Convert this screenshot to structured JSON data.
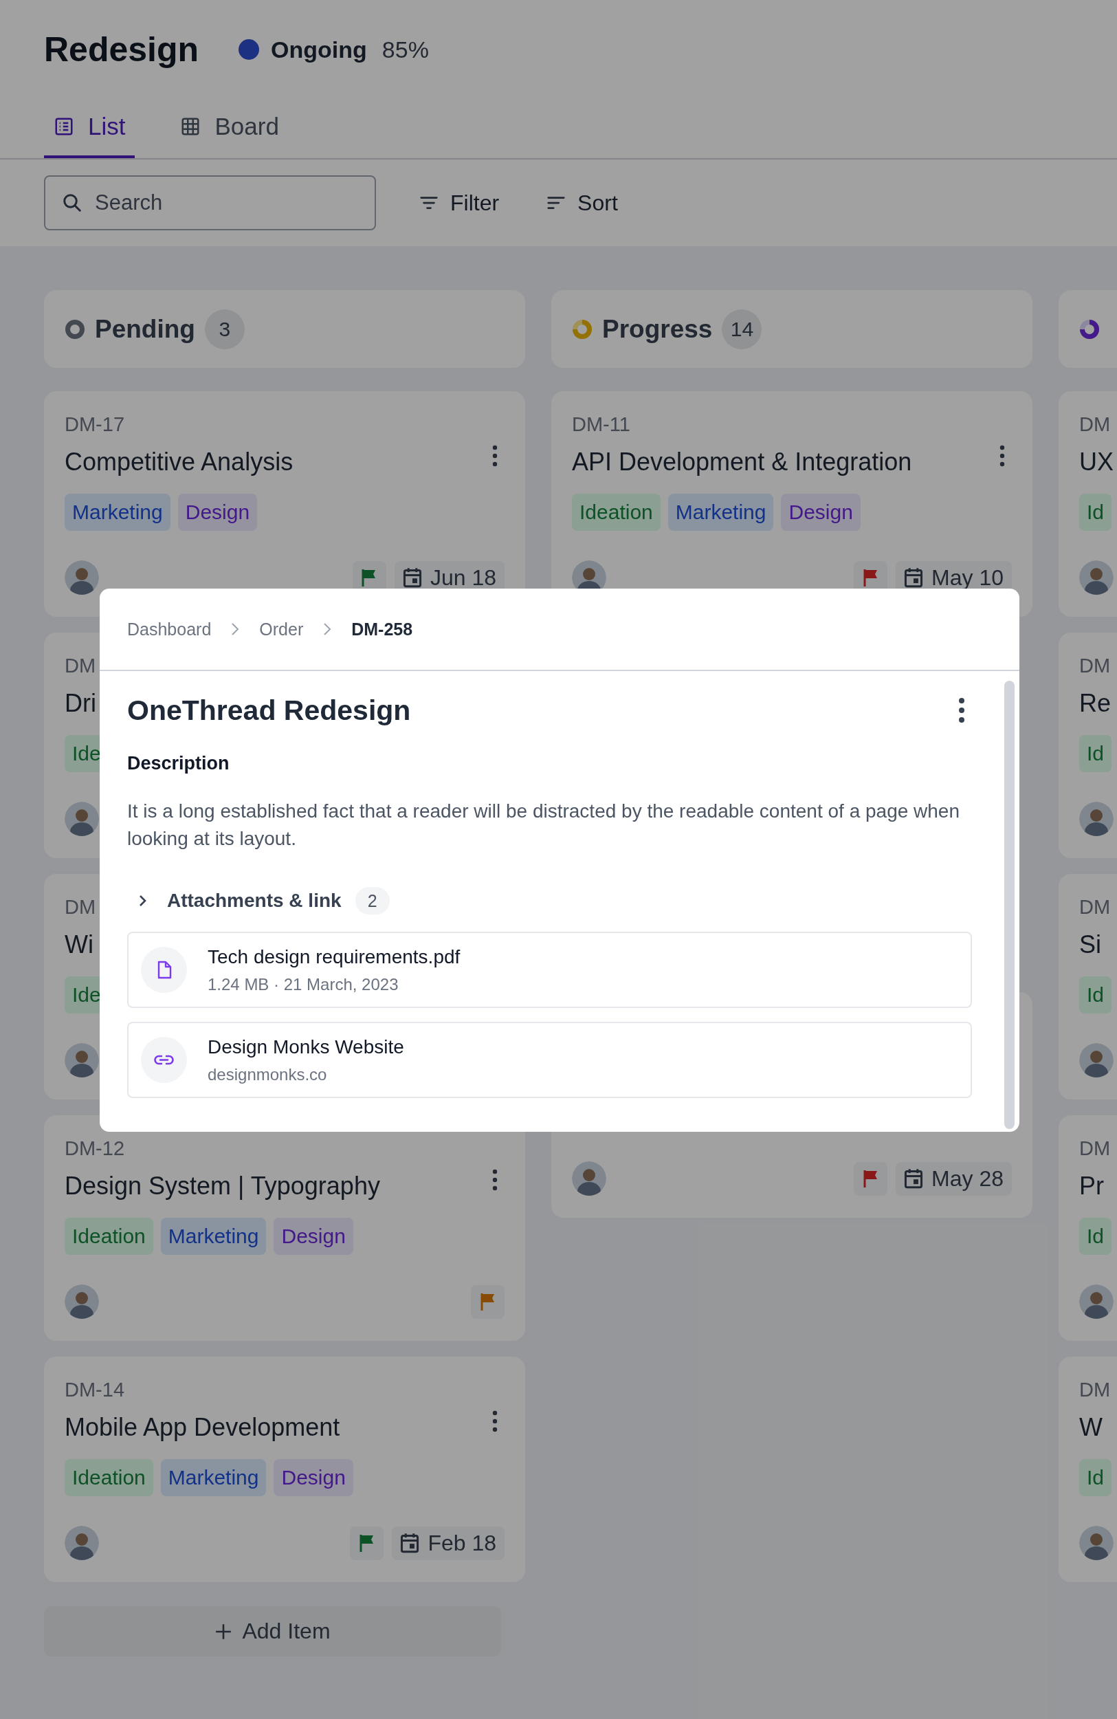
{
  "header": {
    "title": "Redesign",
    "status": {
      "label": "Ongoing"
    },
    "progress": "85%"
  },
  "tabs": [
    {
      "label": "List",
      "kind": "list",
      "selected": true
    },
    {
      "label": "Board",
      "kind": "board",
      "selected": false
    }
  ],
  "toolbar": {
    "search": {
      "placeholder": "Search"
    },
    "buttons": [
      {
        "label": "Filter",
        "kind": "filter"
      },
      {
        "label": "Sort",
        "kind": "sort"
      }
    ]
  },
  "columns": [
    {
      "title": "Pending",
      "count": "3",
      "kind": "pending",
      "add_button": "Add Item",
      "cards": [
        {
          "id": "DM-17",
          "title": "Competitive Analysis",
          "menu": true,
          "tags": [
            {
              "label": "Marketing",
              "kind": "marketing"
            },
            {
              "label": "Design",
              "kind": "design"
            }
          ],
          "avatar": true,
          "flag": {
            "kind": "low"
          },
          "date": "Jun 18"
        },
        {
          "id": "DM",
          "title": "Dri",
          "tags": [
            {
              "label": "Ide",
              "kind": "ideation"
            }
          ],
          "avatar": true
        },
        {
          "id": "DM",
          "title": "Wi",
          "tags": [
            {
              "label": "Ide",
              "kind": "ideation"
            }
          ],
          "avatar": true
        },
        {
          "id": "DM-12",
          "title": "Design System | Typography",
          "menu": true,
          "tags": [
            {
              "label": "Ideation",
              "kind": "ideation"
            },
            {
              "label": "Marketing",
              "kind": "marketing"
            },
            {
              "label": "Design",
              "kind": "design"
            }
          ],
          "avatar": true,
          "flag": {
            "kind": "medium"
          }
        },
        {
          "id": "DM-14",
          "title": "Mobile App Development",
          "menu": true,
          "tags": [
            {
              "label": "Ideation",
              "kind": "ideation"
            },
            {
              "label": "Marketing",
              "kind": "marketing"
            },
            {
              "label": "Design",
              "kind": "design"
            }
          ],
          "avatar": true,
          "flag": {
            "kind": "low"
          },
          "date": "Feb 18"
        }
      ]
    },
    {
      "title": "Progress",
      "count": "14",
      "kind": "progress",
      "cards": [
        {
          "id": "DM-11",
          "title": "API Development & Integration",
          "menu": true,
          "tags": [
            {
              "label": "Ideation",
              "kind": "ideation"
            },
            {
              "label": "Marketing",
              "kind": "marketing"
            },
            {
              "label": "Design",
              "kind": "design"
            }
          ],
          "avatar": true,
          "flag": {
            "kind": "high"
          },
          "date": "May 10"
        },
        {
          "avatar": true,
          "flag": {
            "kind": "high"
          },
          "date": "May 28"
        }
      ]
    },
    {
      "kind": "other",
      "cards": [
        {
          "id": "DM",
          "title": "UX",
          "tags": [
            {
              "label": "Id",
              "kind": "ideation"
            }
          ],
          "avatar": true
        },
        {
          "id": "DM",
          "title": "Re",
          "tags": [
            {
              "label": "Id",
              "kind": "ideation"
            }
          ],
          "avatar": true
        },
        {
          "id": "DM",
          "title": "Si",
          "tags": [
            {
              "label": "Id",
              "kind": "ideation"
            }
          ],
          "avatar": true
        },
        {
          "id": "DM",
          "title": "Pr",
          "tags": [
            {
              "label": "Id",
              "kind": "ideation"
            }
          ],
          "avatar": true
        },
        {
          "id": "DM",
          "title": "W",
          "tags": [
            {
              "label": "Id",
              "kind": "ideation"
            }
          ],
          "avatar": true
        }
      ]
    }
  ],
  "modal": {
    "breadcrumbs": [
      {
        "label": "Dashboard",
        "selected": false
      },
      {
        "label": "Order",
        "selected": false
      },
      {
        "label": "DM-258",
        "selected": true
      }
    ],
    "title": "OneThread Redesign",
    "description_label": "Description",
    "description": "It is a long established fact that a reader will be distracted by the readable content of a page when looking at its layout.",
    "attachments": {
      "label": "Attachments & link",
      "count": "2",
      "expanded": false,
      "items": [
        {
          "kind": "file",
          "name": "Tech design requirements.pdf",
          "meta": "1.24 MB · 21 March, 2023"
        },
        {
          "kind": "link",
          "name": "Design Monks Website",
          "meta": "designmonks.co"
        }
      ]
    }
  }
}
